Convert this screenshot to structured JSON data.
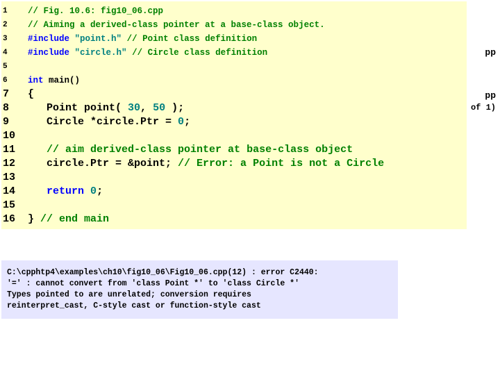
{
  "bg_right": {
    "line1": "pp",
    "line2": "pp",
    "line3": "of 1)"
  },
  "lines": [
    {
      "num": "1",
      "size": "sm",
      "html": "<span class='comment'>// Fig. 10.6: fig10_06.cpp</span>"
    },
    {
      "num": "2",
      "size": "sm",
      "html": "<span class='comment'>// Aiming a derived-class pointer at a base-class object.</span>"
    },
    {
      "num": "3",
      "size": "sm",
      "html": "<span class='preproc'>#include</span> <span class='string'>\"point.h\"</span>   <span class='comment'>// Point class definition</span>"
    },
    {
      "num": "4",
      "size": "sm",
      "html": "<span class='preproc'>#include</span> <span class='string'>\"circle.h\"</span>  <span class='comment'>// Circle class definition</span>"
    },
    {
      "num": "5",
      "size": "sm",
      "html": "&nbsp;"
    },
    {
      "num": "6",
      "size": "sm",
      "html": "<span class='keyword'>int</span> main()"
    },
    {
      "num": "7",
      "size": "lg",
      "html": "{"
    },
    {
      "num": "8",
      "size": "lg",
      "html": "&nbsp;&nbsp;&nbsp;Point point( <span class='number'>30</span>, <span class='number'>50</span> );"
    },
    {
      "num": "9",
      "size": "lg",
      "html": "&nbsp;&nbsp;&nbsp;Circle *circle.Ptr = <span class='number'>0</span>;"
    },
    {
      "num": "10",
      "size": "lg",
      "html": "&nbsp;"
    },
    {
      "num": "11",
      "size": "lg",
      "html": "&nbsp;&nbsp;&nbsp;<span class='comment'>// aim derived-class pointer at base-class object</span>"
    },
    {
      "num": "12",
      "size": "lg",
      "html": "&nbsp;&nbsp;&nbsp;circle.Ptr = &amp;point;  <span class='comment'>// Error: a Point is not a Circle</span>"
    },
    {
      "num": "13",
      "size": "lg",
      "html": "&nbsp;"
    },
    {
      "num": "14",
      "size": "lg",
      "html": "&nbsp;&nbsp;&nbsp;<span class='keyword'>return</span> <span class='number'>0</span>;"
    },
    {
      "num": "15",
      "size": "lg",
      "html": "&nbsp;"
    },
    {
      "num": "16",
      "size": "lg",
      "html": "} <span class='comment'>// end main</span>"
    }
  ],
  "error": {
    "l1": "C:\\cpphtp4\\examples\\ch10\\fig10_06\\Fig10_06.cpp(12) : error C2440:",
    "l2": "'=' : cannot convert from 'class Point *' to 'class Circle *'",
    "l3": "        Types pointed to are unrelated; conversion requires",
    "l4": "        reinterpret_cast, C-style cast or function-style cast"
  }
}
